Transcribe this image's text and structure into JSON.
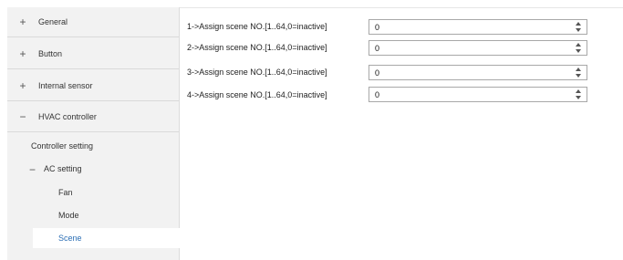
{
  "sidebar": {
    "sections": [
      {
        "symbol": "+",
        "label": "General"
      },
      {
        "symbol": "+",
        "label": "Button"
      },
      {
        "symbol": "+",
        "label": "Internal sensor"
      },
      {
        "symbol": "−",
        "label": "HVAC controller"
      }
    ],
    "controller_setting": "Controller setting",
    "ac_setting": {
      "symbol": "−",
      "label": "AC setting"
    },
    "ac_items": [
      "Fan",
      "Mode",
      "Scene"
    ],
    "selected_item": "Scene"
  },
  "main": {
    "rows": [
      {
        "label": "1->Assign scene NO.[1..64,0=inactive]",
        "value": "0"
      },
      {
        "label": "2->Assign scene NO.[1..64,0=inactive]",
        "value": "0"
      },
      {
        "label": "3->Assign scene NO.[1..64,0=inactive]",
        "value": "0"
      },
      {
        "label": "4->Assign scene NO.[1..64,0=inactive]",
        "value": "0"
      }
    ]
  }
}
